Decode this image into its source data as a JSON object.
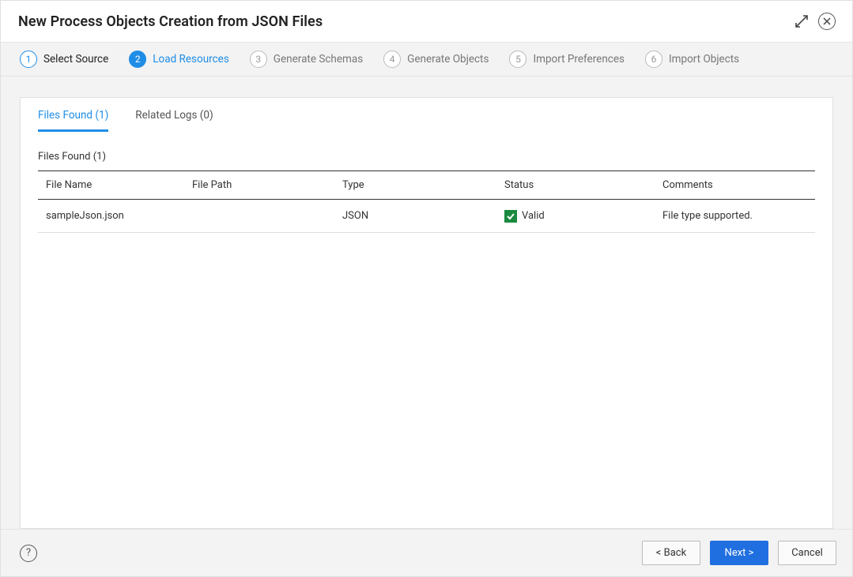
{
  "header": {
    "title": "New Process Objects Creation from JSON Files"
  },
  "steps": [
    {
      "num": "1",
      "label": "Select Source",
      "state": "completed"
    },
    {
      "num": "2",
      "label": "Load Resources",
      "state": "active"
    },
    {
      "num": "3",
      "label": "Generate Schemas",
      "state": "pending"
    },
    {
      "num": "4",
      "label": "Generate Objects",
      "state": "pending"
    },
    {
      "num": "5",
      "label": "Import Preferences",
      "state": "pending"
    },
    {
      "num": "6",
      "label": "Import Objects",
      "state": "pending"
    }
  ],
  "tabs": {
    "files_found": "Files Found (1)",
    "related_logs": "Related Logs (0)"
  },
  "section": {
    "title": "Files Found (1)"
  },
  "table": {
    "headers": {
      "name": "File Name",
      "path": "File Path",
      "type": "Type",
      "status": "Status",
      "comments": "Comments"
    },
    "rows": [
      {
        "name": "sampleJson.json",
        "path": "",
        "type": "JSON",
        "status": "Valid",
        "status_kind": "valid",
        "comments": "File type supported."
      }
    ]
  },
  "footer": {
    "help": "?",
    "back": "< Back",
    "next": "Next >",
    "cancel": "Cancel"
  },
  "colors": {
    "accent": "#1f8de6",
    "primary_button": "#1f6fe0",
    "valid_badge": "#1a8a3f"
  }
}
